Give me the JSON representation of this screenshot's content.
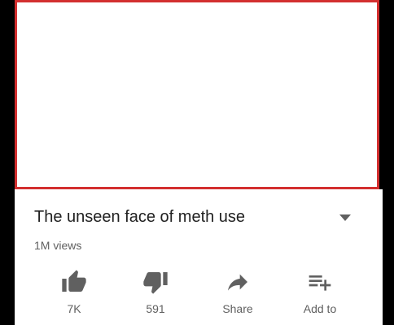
{
  "video": {
    "title": "The unseen face of meth use",
    "views": "1M views"
  },
  "actions": {
    "like": {
      "label": "7K",
      "icon": "thumbs-up-icon"
    },
    "dislike": {
      "label": "591",
      "icon": "thumbs-down-icon"
    },
    "share": {
      "label": "Share",
      "icon": "share-arrow-icon"
    },
    "add_to": {
      "label": "Add to",
      "icon": "playlist-add-icon"
    }
  },
  "colors": {
    "player_border": "#d32f2f",
    "icon": "#606060",
    "title": "#212121",
    "secondary_text": "#606060"
  }
}
